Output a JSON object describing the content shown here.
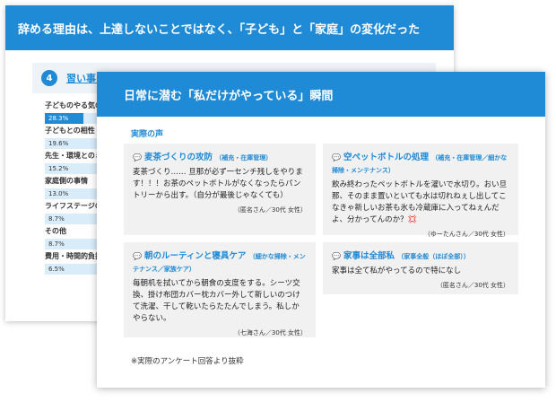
{
  "back": {
    "title": "辞める理由は、上達しないことではなく、「子ども」と「家庭」の変化だった",
    "section_number": "4",
    "section_title": "習い事を辞めた主な理由ランキング",
    "ranking": [
      {
        "label": "子どものやる気の低下",
        "value_text": "28.3%",
        "value": 28.3
      },
      {
        "label": "子どもとの相性",
        "value_text": "19.6%",
        "value": 19.6
      },
      {
        "label": "先生・環境とのミスマッチ",
        "value_text": "15.2%",
        "value": 15.2
      },
      {
        "label": "家庭側の事情",
        "value_text": "13.0%",
        "value": 13.0
      },
      {
        "label": "ライフステージの変化",
        "value_text": "8.7%",
        "value": 8.7
      },
      {
        "label": "その他",
        "value_text": "8.7%",
        "value": 8.7
      },
      {
        "label": "費用・時間的負担",
        "value_text": "6.5%",
        "value": 6.5
      }
    ]
  },
  "front": {
    "title": "日常に潜む「私だけがやっている」瞬間",
    "voices_heading": "実際の声",
    "cards": [
      {
        "title": "麦茶づくりの攻防",
        "tag": "（補充・在庫管理）",
        "body": "麦茶づくり…… 旦那が必ず一センチ残しをやります！！！お茶のペットボトルがなくなったらパントリーから出す。（自分が最後じゃなくても）",
        "attribution": "（匿名さん／30代 女性）"
      },
      {
        "title": "空ペットボトルの処理",
        "tag": "（補充・在庫管理／細かな掃除・メンテナンス）",
        "body": "飲み終わったペットボトルを濯いで水切り。おい旦那、そのまま置いといても水は切れねぇし出してこなきゃ新しいお茶も氷も冷蔵庫に入ってねぇんだよ、分かってんのか？💢",
        "attribution": "（ゆーたんさん／30代 女性）"
      },
      {
        "title": "朝のルーティンと寝具ケア",
        "tag": "（細かな掃除・メンテナンス／家族ケア）",
        "body": "毎朝机を拭いてから朝食の支度をする。シーツ交換、掛け布団カバー枕カバー外して新しいのつけて洗濯、干して乾いたらたたんでしまう。私しかやらない。",
        "attribution": "（七海さん／30代 女性）"
      },
      {
        "title": "家事は全部私",
        "tag": "（家事全般（ほぼ全部））",
        "body": "家事は全て私がやってるので特になし",
        "attribution": "（匿名さん／30代 女性）"
      }
    ],
    "footnote": "※実際のアンケート回答より抜粋"
  },
  "colors": {
    "accent": "#1f8ad6",
    "card_bg": "#f1f1f1"
  },
  "icons": {
    "comment": "speech-bubble-icon"
  }
}
